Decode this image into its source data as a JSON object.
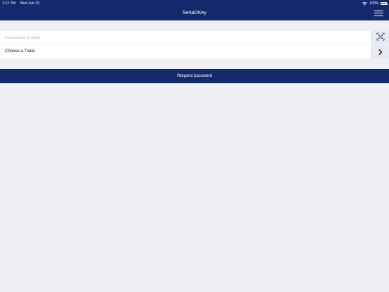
{
  "status_bar": {
    "time": "1:12 PM",
    "date": "Wed Jun 19",
    "battery_percent": "100%"
  },
  "header": {
    "title": "Serial2Key"
  },
  "form": {
    "serial_placeholder": "Serialnumber (8 digits)",
    "serial_value": "",
    "trade_label": "Choose a Trade"
  },
  "actions": {
    "request_password_label": "Request password"
  },
  "colors": {
    "brand": "#13296c",
    "background": "#efeff4",
    "row_background": "#ffffff",
    "side_button_background": "#e8eaf3"
  },
  "icons": {
    "menu": "hamburger-menu-icon",
    "scan": "qr-scan-icon",
    "chevron": "chevron-right-icon",
    "wifi": "wifi-icon",
    "battery": "battery-icon"
  }
}
